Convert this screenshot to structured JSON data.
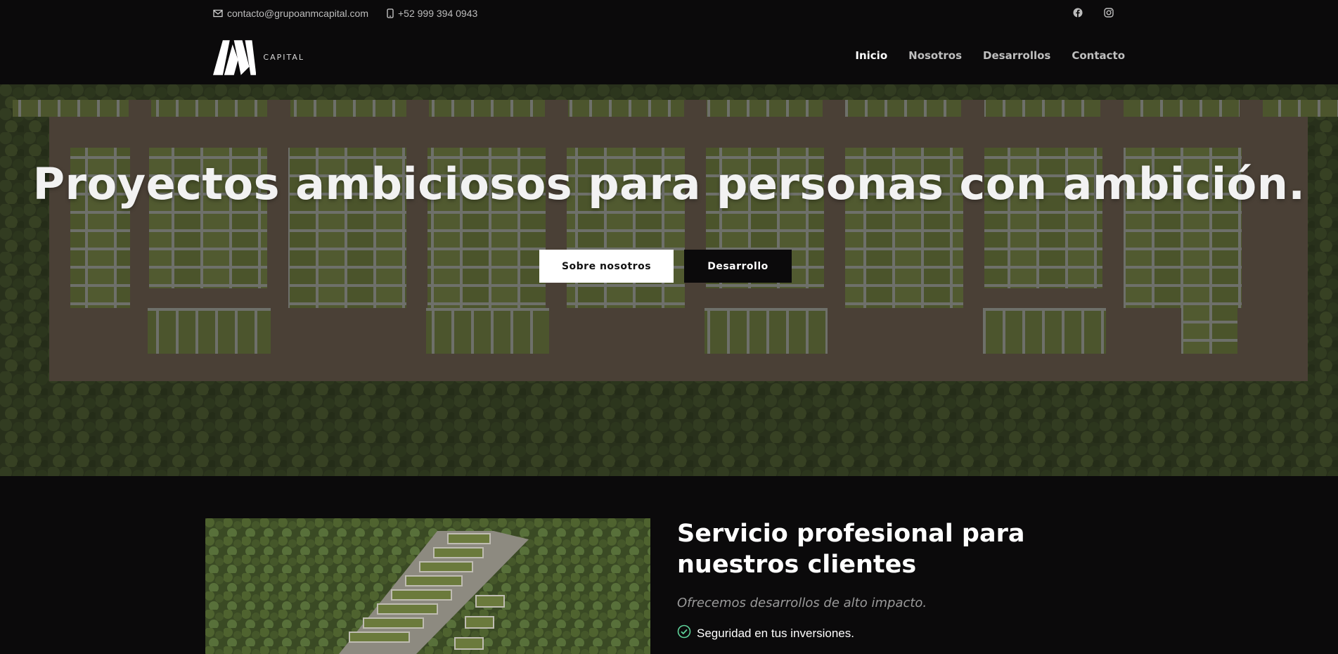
{
  "topbar": {
    "email": "contacto@grupoanmcapital.com",
    "phone": "+52 999 394 0943",
    "email_icon": "envelope-icon",
    "phone_icon": "mobile-phone-icon",
    "social": [
      "facebook-icon",
      "instagram-icon"
    ]
  },
  "header": {
    "logo_text": "CAPITAL",
    "nav": [
      {
        "label": "Inicio",
        "active": true
      },
      {
        "label": "Nosotros",
        "active": false
      },
      {
        "label": "Desarrollos",
        "active": false
      },
      {
        "label": "Contacto",
        "active": false
      }
    ]
  },
  "hero": {
    "title": "Proyectos ambiciosos para personas con ambición.",
    "primary_button": "Sobre nosotros",
    "secondary_button": "Desarrollo"
  },
  "service": {
    "title": "Servicio profesional para nuestros clientes",
    "subtitle": "Ofrecemos desarrollos de alto impacto.",
    "features": [
      "Seguridad en tus inversiones."
    ],
    "check_icon": "check-circle-icon"
  },
  "colors": {
    "background": "#0b0a0b",
    "accent_check": "#5fd39a",
    "button_light": "#ffffff",
    "button_dark": "#0b0a0b"
  }
}
